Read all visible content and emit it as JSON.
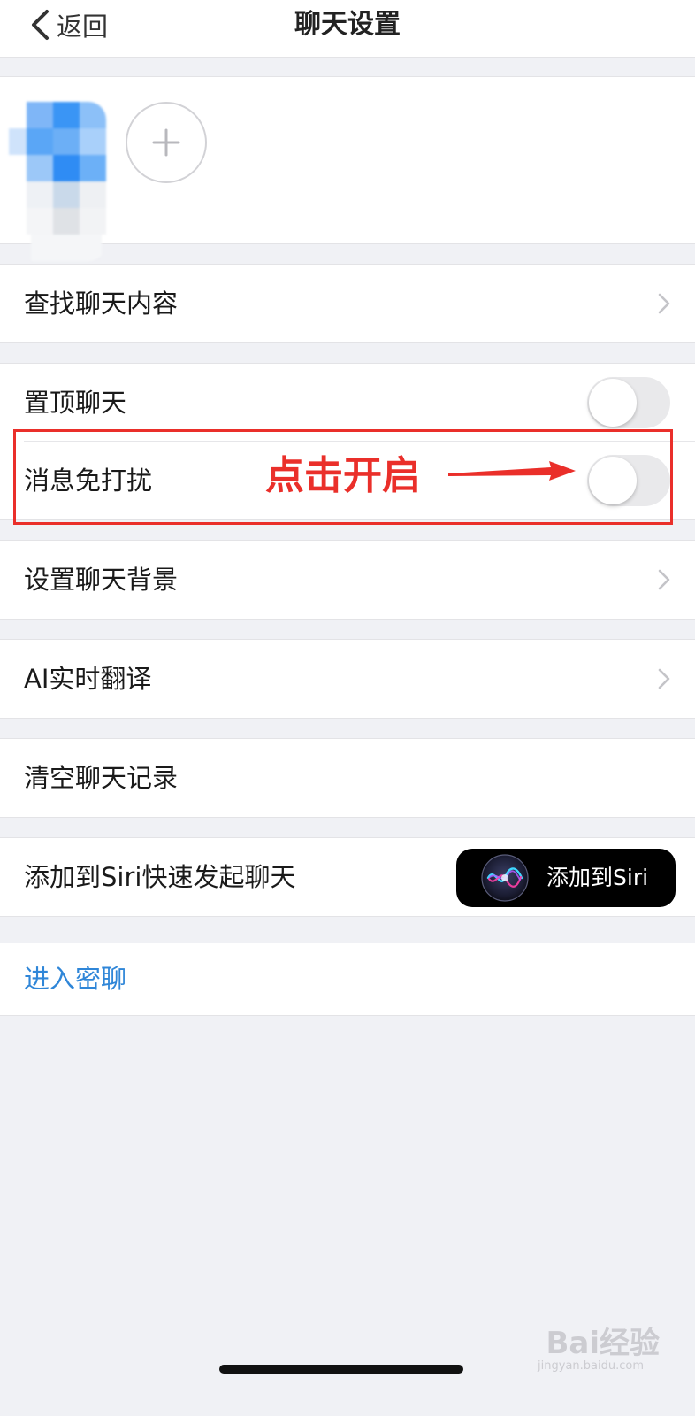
{
  "nav": {
    "back_label": "返回",
    "title": "聊天设置"
  },
  "members": {
    "add_icon": "plus-icon"
  },
  "rows": {
    "search_history": "查找聊天内容",
    "pin_chat": "置顶聊天",
    "mute_notifications": "消息免打扰",
    "chat_background": "设置聊天背景",
    "ai_translate": "AI实时翻译",
    "clear_history": "清空聊天记录",
    "add_to_siri": "添加到Siri快速发起聊天",
    "secret_chat": "进入密聊"
  },
  "toggles": {
    "pin_chat_on": false,
    "mute_notifications_on": false
  },
  "siri_button": {
    "label": "添加到Siri",
    "icon": "siri-orb-icon"
  },
  "annotation": {
    "text": "点击开启",
    "color": "#ea2f2a"
  },
  "watermark": {
    "text": "Bai经验",
    "sub": "jingyan.baidu.com"
  },
  "colors": {
    "link": "#2f86d8",
    "background": "#f0f1f5",
    "toggle_off": "#e9e9eb"
  }
}
